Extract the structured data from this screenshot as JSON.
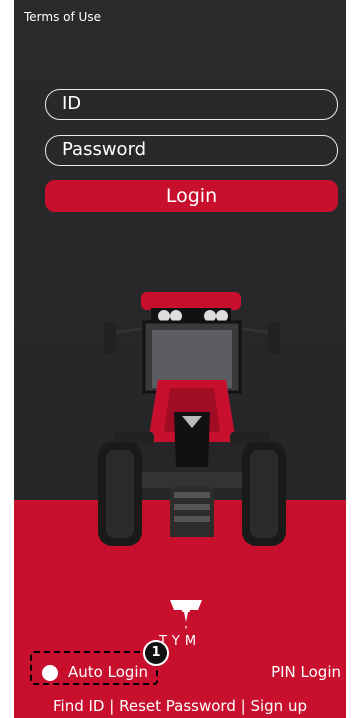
{
  "header": {
    "terms_label": "Terms of Use"
  },
  "form": {
    "id_placeholder": "ID",
    "password_placeholder": "Password",
    "login_label": "Login"
  },
  "brand": {
    "name": "TYM",
    "accent": "#c8102e"
  },
  "auto_login": {
    "label": "Auto Login",
    "badge": "1",
    "checked": false
  },
  "pin_login_label": "PIN Login",
  "footer": {
    "find_id": "Find ID",
    "separator": "|",
    "reset_password": "Reset Password",
    "sign_up": "Sign up"
  },
  "icons": [
    "tractor-image",
    "tym-logo-icon",
    "radio-icon"
  ]
}
